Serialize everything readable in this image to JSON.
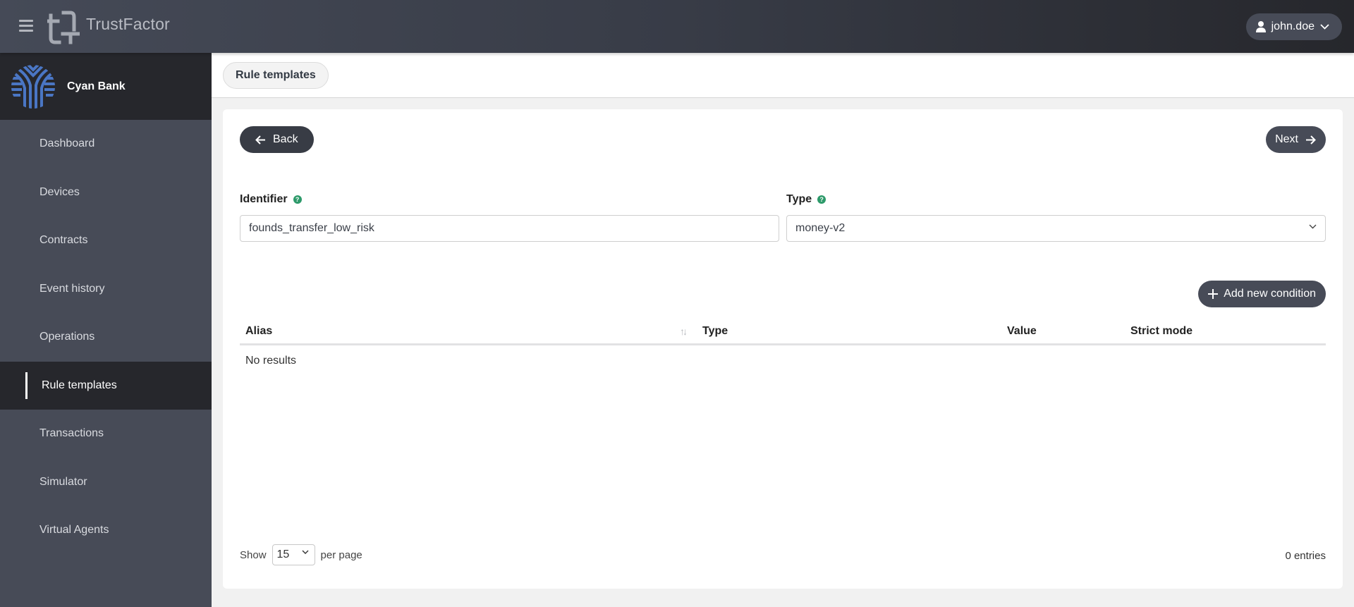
{
  "header": {
    "app_title": "TrustFactor",
    "user": "john.doe",
    "menu_icon": "hamburger-icon",
    "user_icon": "user-icon"
  },
  "sidebar": {
    "brand_name": "Cyan Bank",
    "brand_color": "#4a76c4",
    "items": [
      {
        "label": "Dashboard",
        "active": false
      },
      {
        "label": "Devices",
        "active": false
      },
      {
        "label": "Contracts",
        "active": false
      },
      {
        "label": "Event history",
        "active": false
      },
      {
        "label": "Operations",
        "active": false
      },
      {
        "label": "Rule templates",
        "active": true
      },
      {
        "label": "Transactions",
        "active": false
      },
      {
        "label": "Simulator",
        "active": false
      },
      {
        "label": "Virtual Agents",
        "active": false
      }
    ]
  },
  "breadcrumb": {
    "current": "Rule templates"
  },
  "form": {
    "back_label": "Back",
    "next_label": "Next",
    "identifier": {
      "label": "Identifier",
      "value": "founds_transfer_low_risk"
    },
    "type": {
      "label": "Type",
      "value": "money-v2"
    },
    "help_glyph": "?",
    "help_color": "#2d9a6a"
  },
  "conditions": {
    "add_label": "Add new condition",
    "columns": [
      "Alias",
      "Type",
      "Value",
      "Strict mode"
    ],
    "rows": [],
    "empty_text": "No results",
    "show_label": "Show",
    "per_page_value": "15",
    "per_page_label": "per page",
    "entries_text": "0 entries"
  }
}
